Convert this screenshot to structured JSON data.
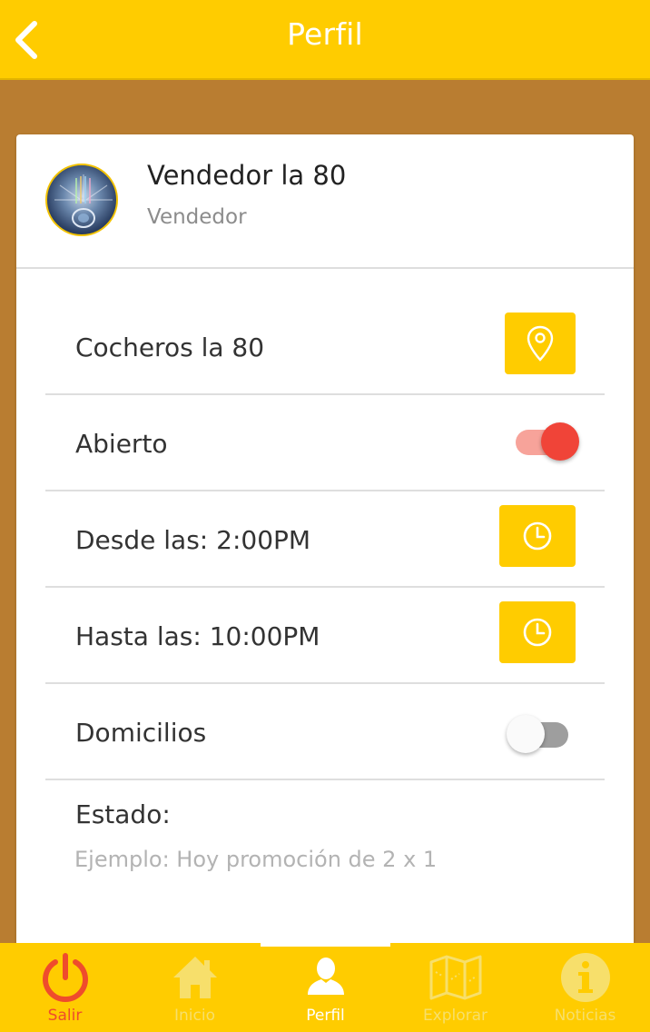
{
  "header": {
    "title": "Perfil"
  },
  "profile": {
    "name": "Vendedor la 80",
    "role": "Vendedor"
  },
  "rows": {
    "location": {
      "label": "Cocheros la 80"
    },
    "open": {
      "label": "Abierto",
      "on": true
    },
    "from": {
      "label": "Desde las: 2:00PM"
    },
    "to": {
      "label": "Hasta las: 10:00PM"
    },
    "delivery": {
      "label": "Domicilios",
      "on": false
    }
  },
  "status": {
    "label": "Estado:",
    "placeholder": "Ejemplo: Hoy promoción de 2 x 1",
    "value": ""
  },
  "tabs": [
    {
      "label": "Salir",
      "icon": "power-icon",
      "active": false
    },
    {
      "label": "Inicio",
      "icon": "home-icon",
      "active": false
    },
    {
      "label": "Perfil",
      "icon": "user-icon",
      "active": true
    },
    {
      "label": "Explorar",
      "icon": "map-icon",
      "active": false
    },
    {
      "label": "Noticias",
      "icon": "info-icon",
      "active": false
    }
  ],
  "colors": {
    "primary": "#ffcc00",
    "background": "#b97d31",
    "accent_red": "#f04438",
    "toggle_on_track": "#f7a39a",
    "toggle_off_track": "#9e9e9e",
    "tab_inactive": "#f7df6b",
    "exit_red": "#ef4c2c"
  }
}
